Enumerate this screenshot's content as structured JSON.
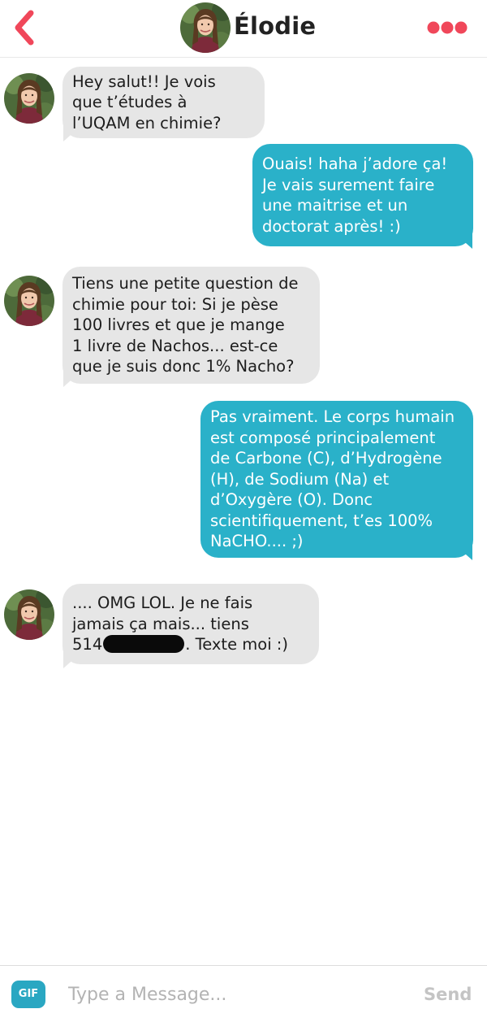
{
  "header": {
    "contact_name": "Élodie",
    "back_icon": "chevron-left-icon",
    "more_icon": "more-dots-icon",
    "accent_color": "#f0475a"
  },
  "messages": [
    {
      "direction": "incoming",
      "text": "Hey salut!! Je vois\nque t’études à\nl’UQAM en chimie?"
    },
    {
      "direction": "outgoing",
      "text": "Ouais! haha j’adore ça!\nJe vais surement faire\nune maitrise et un\ndoctorat après! :)"
    },
    {
      "direction": "incoming",
      "text": "Tiens une petite question de\nchimie pour toi: Si je pèse\n100 livres et que je mange\n1 livre de Nachos... est-ce\nque je suis donc 1% Nacho?"
    },
    {
      "direction": "outgoing",
      "text": "Pas vraiment. Le corps humain\nest composé principalement\nde Carbone (C), d’Hydrogène\n(H), de Sodium  (Na) et\nd’Oxygère (O). Donc\nscientifiquement, t’es 100%\nNaCHO.... ;)"
    },
    {
      "direction": "incoming",
      "text_line1": ".... OMG LOL. Je ne fais",
      "text_line2": "jamais ça mais... tiens",
      "text_prefix": "514",
      "text_suffix": ". Texte moi :)"
    }
  ],
  "composer": {
    "gif_label": "GIF",
    "placeholder": "Type a Message...",
    "send_label": "Send"
  },
  "colors": {
    "incoming_bubble": "#e6e6e6",
    "outgoing_bubble": "#2ab1c9",
    "gif_button": "#2aa7c2"
  }
}
